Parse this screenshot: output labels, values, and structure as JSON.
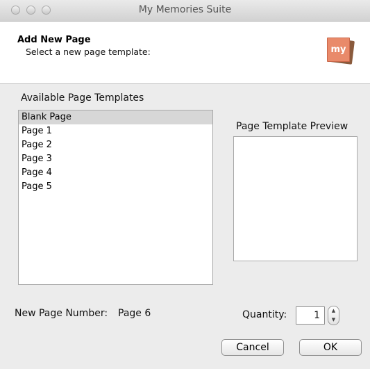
{
  "window": {
    "title": "My Memories Suite"
  },
  "header": {
    "title": "Add New Page",
    "subtitle": "Select a new page template:",
    "logo_text": "my"
  },
  "templates": {
    "label": "Available Page Templates",
    "items": [
      "Blank Page",
      "Page 1",
      "Page 2",
      "Page 3",
      "Page 4",
      "Page 5"
    ],
    "selected": "Blank Page"
  },
  "preview": {
    "label": "Page Template Preview"
  },
  "page_number": {
    "label": "New Page Number:",
    "value": "Page 6"
  },
  "quantity": {
    "label": "Quantity:",
    "value": "1"
  },
  "buttons": {
    "cancel": "Cancel",
    "ok": "OK"
  },
  "colors": {
    "dialog_bg": "#ececec",
    "selection": "#d7d7d7",
    "logo": "#e98a6a"
  }
}
